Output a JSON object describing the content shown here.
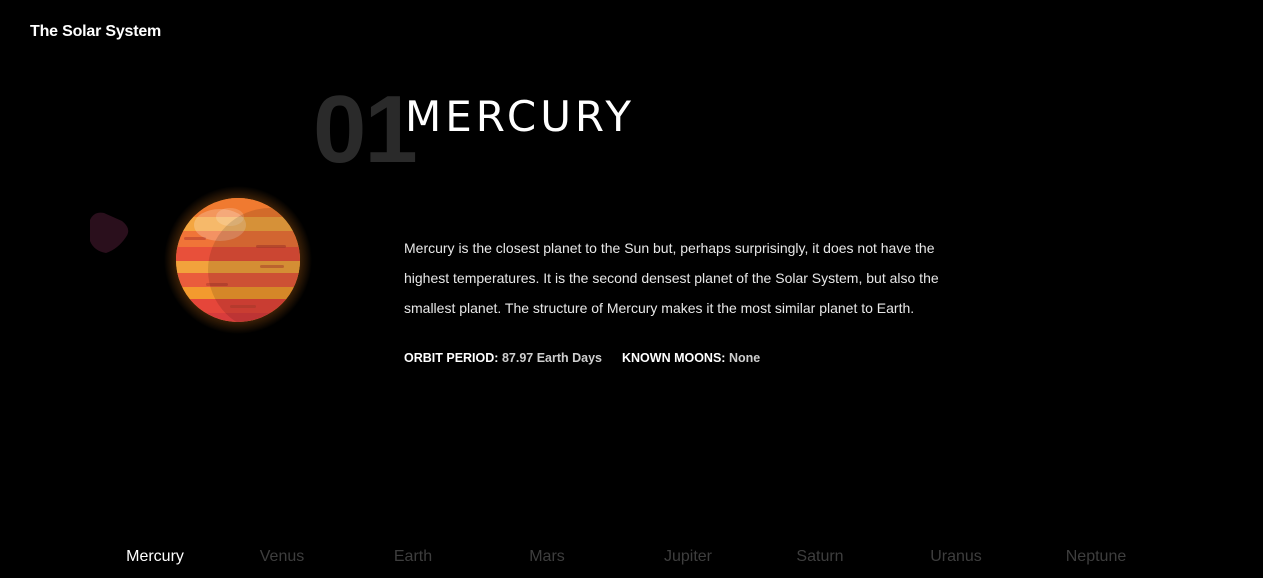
{
  "header": {
    "site_title": "The Solar System"
  },
  "planet": {
    "number": "01",
    "name": "MERCURY",
    "description": "Mercury is the closest planet to the Sun but, perhaps surprisingly, it does not have the highest temperatures. It is the second densest planet of the Solar System, but also the smallest planet. The structure of Mercury makes it the most similar planet to Earth.",
    "stats": {
      "orbit_label": "ORBIT PERIOD:",
      "orbit_value": "87.97 Earth Days",
      "moons_label": "KNOWN MOONS:",
      "moons_value": "None"
    }
  },
  "nav": {
    "items": [
      {
        "label": "Mercury",
        "active": true
      },
      {
        "label": "Venus",
        "active": false
      },
      {
        "label": "Earth",
        "active": false
      },
      {
        "label": "Mars",
        "active": false
      },
      {
        "label": "Jupiter",
        "active": false
      },
      {
        "label": "Saturn",
        "active": false
      },
      {
        "label": "Uranus",
        "active": false
      },
      {
        "label": "Neptune",
        "active": false
      }
    ]
  },
  "colors": {
    "background": "#000000",
    "text": "#ffffff",
    "muted_nav": "#3e3e3e",
    "number_watermark": "#2a2a2a",
    "planet_orange": "#f39a2e",
    "planet_red": "#e8503a",
    "planet_glow": "#ff8a1e"
  }
}
